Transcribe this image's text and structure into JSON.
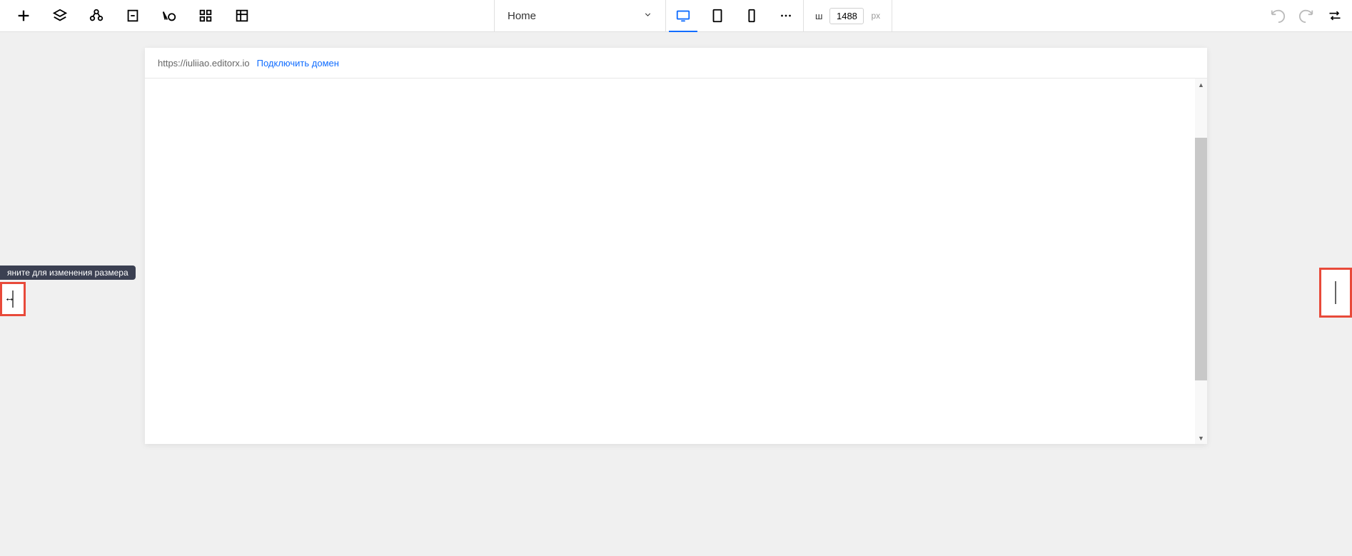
{
  "toolbar": {
    "page_name": "Home",
    "width_label": "ш",
    "width_value": "1488",
    "width_unit": "px"
  },
  "url_bar": {
    "url": "https://iuliiao.editorx.io",
    "connect_label": "Подключить домен"
  },
  "tooltip": {
    "resize_text": "яните для изменения размера"
  }
}
